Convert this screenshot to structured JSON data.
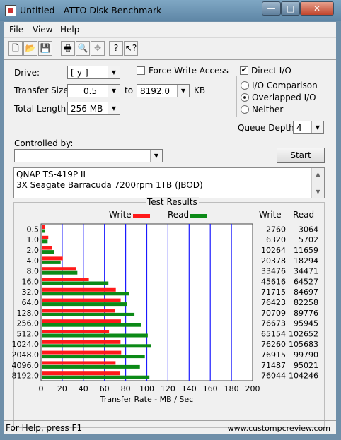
{
  "window": {
    "title": "Untitled - ATTO Disk Benchmark",
    "min": "—",
    "max": "□",
    "close": "✕"
  },
  "menu": [
    "File",
    "View",
    "Help"
  ],
  "toolbar_icons": [
    "new-icon",
    "open-icon",
    "save-icon",
    "print-icon",
    "print-preview-icon",
    "move-icon",
    "help-icon",
    "context-help-icon"
  ],
  "settings": {
    "drive_label": "Drive:",
    "drive_value": "[-y-]",
    "force_write_access_label": "Force Write Access",
    "force_write_access": false,
    "direct_io_label": "Direct I/O",
    "direct_io": true,
    "transfer_size_label": "Transfer Size:",
    "transfer_size_from": "0.5",
    "to_label": "to",
    "transfer_size_to": "8192.0",
    "kb_label": "KB",
    "total_length_label": "Total Length:",
    "total_length_value": "256 MB",
    "io_options": [
      "I/O Comparison",
      "Overlapped I/O",
      "Neither"
    ],
    "io_selected": "Overlapped I/O",
    "queue_depth_label": "Queue Depth:",
    "queue_depth_value": "4",
    "controlled_by_label": "Controlled by:",
    "controlled_by_value": "",
    "start_label": "Start"
  },
  "description": [
    "QNAP TS-419P II",
    "3X Seagate Barracuda 7200rpm 1TB (JBOD)"
  ],
  "results": {
    "title": "Test Results",
    "write_legend": "Write",
    "read_legend": "Read",
    "write_header": "Write",
    "read_header": "Read",
    "colors": {
      "write": "#ff1a1a",
      "read": "#0c8a17",
      "grid": "#1a1aff"
    }
  },
  "chart_data": {
    "type": "bar",
    "orientation": "horizontal",
    "title": "Test Results",
    "xlabel": "Transfer Rate - MB / Sec",
    "xlim": [
      0,
      200
    ],
    "xticks": [
      0,
      20,
      40,
      60,
      80,
      100,
      120,
      140,
      160,
      180,
      200
    ],
    "categories": [
      "0.5",
      "1.0",
      "2.0",
      "4.0",
      "8.0",
      "16.0",
      "32.0",
      "64.0",
      "128.0",
      "256.0",
      "512.0",
      "1024.0",
      "2048.0",
      "4096.0",
      "8192.0"
    ],
    "series": [
      {
        "name": "Write",
        "values": [
          2760,
          6320,
          10264,
          20378,
          33476,
          45616,
          71715,
          76423,
          70709,
          76673,
          65154,
          76260,
          76915,
          71487,
          76044
        ]
      },
      {
        "name": "Read",
        "values": [
          3064,
          5702,
          11659,
          18294,
          34471,
          64527,
          84697,
          82258,
          89776,
          95945,
          102652,
          105683,
          99790,
          95021,
          104246
        ]
      }
    ],
    "grid": true,
    "legend": "top"
  },
  "status": {
    "help": "For Help, press F1",
    "watermark": "www.custompcreview.com"
  }
}
